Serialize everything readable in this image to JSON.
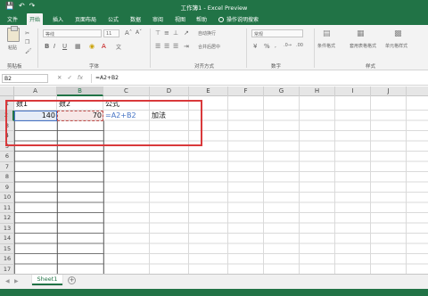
{
  "titlebar": {
    "title": "工作簿1 - Excel Preview",
    "save_icon": "save-icon",
    "undo_icon": "undo-icon",
    "redo_icon": "redo-icon"
  },
  "tabs": [
    "文件",
    "开始",
    "插入",
    "页面布局",
    "公式",
    "数据",
    "审阅",
    "视图",
    "帮助"
  ],
  "active_tab": "开始",
  "tell_me": "操作说明搜索",
  "ribbon": {
    "paste_label": "粘贴",
    "groups": [
      "剪贴板",
      "字体",
      "对齐方式",
      "数字",
      "样式"
    ],
    "font_name": "等线",
    "font_size": "11",
    "wrap_text": "自动换行",
    "merge_center": "合并后居中",
    "number_format": "常规",
    "cond_format": "条件格式",
    "table_format": "套用表格格式",
    "cell_styles": "单元格样式"
  },
  "formula_bar": {
    "name_box": "B2",
    "formula": "=A2+B2"
  },
  "columns": [
    "A",
    "B",
    "C",
    "D",
    "E",
    "F",
    "G",
    "H",
    "I",
    "J"
  ],
  "rows": [
    "1",
    "2",
    "3",
    "4",
    "5",
    "6",
    "7",
    "8",
    "9",
    "10",
    "11",
    "12",
    "13",
    "14",
    "15",
    "16",
    "17"
  ],
  "cells": {
    "A1": "数1",
    "B1": "数2",
    "C1": "公式",
    "A2": "140",
    "B2": "70",
    "C2": "=A2+B2",
    "D2": "加法"
  },
  "formula_ref_colors": {
    "A2": "#4472c4",
    "B2": "#c0504d"
  },
  "annotation_color": "#d9393b",
  "sheet_tab": "Sheet1",
  "accent": "#217346"
}
